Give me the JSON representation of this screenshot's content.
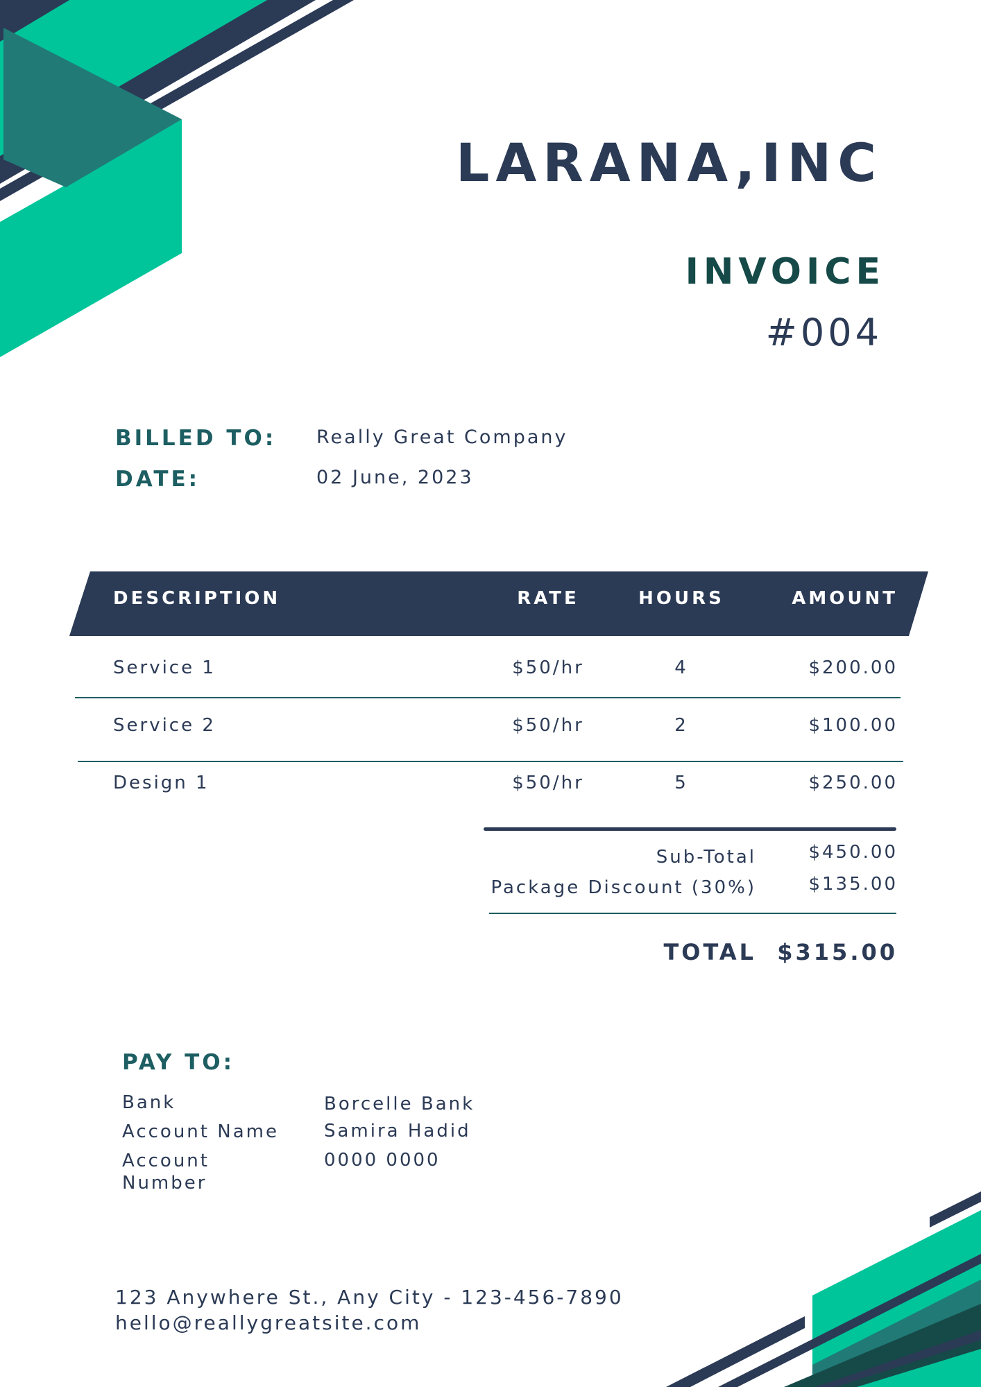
{
  "header": {
    "company": "LARANA,INC",
    "doc_title": "INVOICE",
    "doc_number": "#004"
  },
  "billing": {
    "billed_to_label": "BILLED TO:",
    "billed_to_value": "Really Great Company",
    "date_label": "DATE:",
    "date_value": "02 June, 2023"
  },
  "table": {
    "headers": [
      "DESCRIPTION",
      "RATE",
      "HOURS",
      "AMOUNT"
    ],
    "rows": [
      {
        "description": "Service 1",
        "rate": "$50/hr",
        "hours": "4",
        "amount": "$200.00"
      },
      {
        "description": "Service 2",
        "rate": "$50/hr",
        "hours": "2",
        "amount": "$100.00"
      },
      {
        "description": "Design 1",
        "rate": "$50/hr",
        "hours": "5",
        "amount": "$250.00"
      }
    ]
  },
  "summary": {
    "subtotal_label": "Sub-Total",
    "subtotal_value": "$450.00",
    "discount_label": "Package Discount (30%)",
    "discount_value": "$135.00",
    "total_label": "TOTAL",
    "total_value": "$315.00"
  },
  "payment": {
    "title": "PAY TO:",
    "bank_label": "Bank",
    "bank_value": "Borcelle Bank",
    "account_name_label": "Account Name",
    "account_name_value": "Samira Hadid",
    "account_number_label": "Account Number",
    "account_number_value": "0000 0000"
  },
  "footer": {
    "address": "123 Anywhere St., Any City - 123-456-7890",
    "email": "hello@reallygreatsite.com"
  },
  "colors": {
    "navy": "#2b3a55",
    "green": "#00c49a",
    "teal": "#217a76",
    "dark_teal": "#154a48"
  }
}
